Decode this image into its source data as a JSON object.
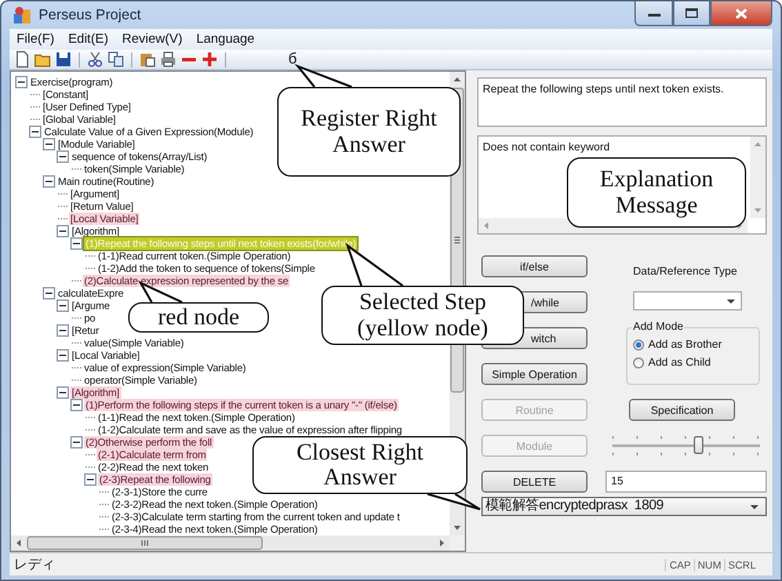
{
  "window": {
    "title": "Perseus Project"
  },
  "menu": [
    "File(F)",
    "Edit(E)",
    "Review(V)",
    "Language"
  ],
  "toolbar": {
    "glyph": "б"
  },
  "tree": {
    "text": "Exercise(program)",
    "flagged": false,
    "selected": false,
    "children": [
      {
        "text": "[Constant]",
        "flagged": false,
        "selected": false
      },
      {
        "text": "[User Defined Type]",
        "flagged": false,
        "selected": false
      },
      {
        "text": "[Global Variable]",
        "flagged": false,
        "selected": false
      },
      {
        "text": "Calculate Value of a Given Expression(Module)",
        "flagged": false,
        "selected": false,
        "children": [
          {
            "text": "[Module Variable]",
            "flagged": false,
            "selected": false,
            "children": [
              {
                "text": "sequence of tokens(Array/List)",
                "flagged": false,
                "selected": false,
                "children": [
                  {
                    "text": "token(Simple Variable)",
                    "flagged": false,
                    "selected": false
                  }
                ]
              }
            ]
          },
          {
            "text": "Main routine(Routine)",
            "flagged": false,
            "selected": false,
            "children": [
              {
                "text": "[Argument]",
                "flagged": false,
                "selected": false
              },
              {
                "text": "[Return Value]",
                "flagged": false,
                "selected": false
              },
              {
                "text": "[Local Variable]",
                "flagged": true,
                "selected": false
              },
              {
                "text": "[Algorithm]",
                "flagged": false,
                "selected": false,
                "children": [
                  {
                    "text": "(1)Repeat the following steps until next token exists(for/while)",
                    "flagged": false,
                    "selected": true,
                    "children": [
                      {
                        "text": "(1-1)Read current token.(Simple Operation)",
                        "flagged": false,
                        "selected": false
                      },
                      {
                        "text": "(1-2)Add the token to sequence of tokens(Simple",
                        "flagged": false,
                        "selected": false
                      }
                    ]
                  },
                  {
                    "text": "(2)Calculate expression represented by the se",
                    "flagged": true,
                    "selected": false
                  }
                ]
              }
            ]
          },
          {
            "text": "calculateExpre",
            "flagged": false,
            "selected": false,
            "children": [
              {
                "text": "[Argume",
                "flagged": false,
                "selected": false,
                "children": [
                  {
                    "text": "po",
                    "flagged": false,
                    "selected": false
                  }
                ]
              },
              {
                "text": "[Retur",
                "flagged": false,
                "selected": false,
                "children": [
                  {
                    "text": "value(Simple Variable)",
                    "flagged": false,
                    "selected": false
                  }
                ]
              },
              {
                "text": "[Local Variable]",
                "flagged": false,
                "selected": false,
                "children": [
                  {
                    "text": "value of expression(Simple Variable)",
                    "flagged": false,
                    "selected": false
                  },
                  {
                    "text": "operator(Simple Variable)",
                    "flagged": false,
                    "selected": false
                  }
                ]
              },
              {
                "text": "[Algorithm]",
                "flagged": true,
                "selected": false,
                "children": [
                  {
                    "text": "(1)Perform the following steps if the current token is a unary \"-\" (if/else)",
                    "flagged": true,
                    "selected": false,
                    "children": [
                      {
                        "text": "(1-1)Read the next token.(Simple Operation)",
                        "flagged": false,
                        "selected": false
                      },
                      {
                        "text": "(1-2)Calculate term and save as the value of expression after flipping",
                        "flagged": false,
                        "selected": false
                      }
                    ]
                  },
                  {
                    "text": "(2)Otherwise perform the foll",
                    "flagged": true,
                    "selected": false,
                    "children": [
                      {
                        "text": "(2-1)Calculate term from",
                        "flagged": true,
                        "selected": false
                      },
                      {
                        "text": "(2-2)Read the next token",
                        "flagged": false,
                        "selected": false
                      },
                      {
                        "text": "(2-3)Repeat the following",
                        "flagged": true,
                        "selected": false,
                        "children": [
                          {
                            "text": "(2-3-1)Store the curre",
                            "flagged": false,
                            "selected": false
                          },
                          {
                            "text": "(2-3-2)Read the next token.(Simple Operation)",
                            "flagged": false,
                            "selected": false
                          },
                          {
                            "text": "(2-3-3)Calculate term starting from the current token and update t",
                            "flagged": false,
                            "selected": false
                          },
                          {
                            "text": "(2-3-4)Read the next token.(Simple Operation)",
                            "flagged": false,
                            "selected": false
                          }
                        ]
                      }
                    ]
                  }
                ]
              }
            ]
          }
        ]
      }
    ]
  },
  "statement": "Repeat the following steps until next token exists.",
  "message": "Does not contain keyword",
  "step_buttons": [
    {
      "label": "if/else",
      "disabled": false
    },
    {
      "label": "/while",
      "disabled": false
    },
    {
      "label": "witch",
      "disabled": false
    },
    {
      "label": "Simple Operation",
      "disabled": false
    },
    {
      "label": "Routine",
      "disabled": true
    },
    {
      "label": "Module",
      "disabled": true
    },
    {
      "label": "DELETE",
      "disabled": false
    }
  ],
  "data_type": {
    "label": "Data/Reference Type"
  },
  "add_mode": {
    "title": "Add Mode",
    "options": [
      {
        "label": "Add as Brother",
        "selected": true
      },
      {
        "label": "Add as Child",
        "selected": false
      }
    ]
  },
  "specification_button": "Specification",
  "slider": {
    "level": 0.58
  },
  "number_field": {
    "value": "15"
  },
  "answer_select": {
    "value": "模範解答encryptedprasx  1809"
  },
  "status_bar": {
    "text": "レディ",
    "indicators": [
      "CAP",
      "NUM",
      "SCRL"
    ]
  },
  "callouts": [
    {
      "text": "Register Right Answer"
    },
    {
      "text": "Explanation Message"
    },
    {
      "text": "red node"
    },
    {
      "text": "Selected Step (yellow node)"
    },
    {
      "text": "Closest Right Answer"
    }
  ]
}
